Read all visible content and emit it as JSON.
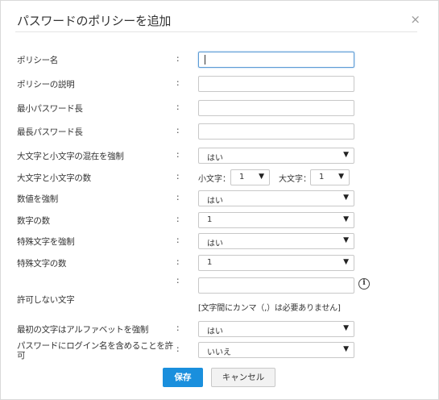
{
  "dialog": {
    "title": "パスワードのポリシーを追加",
    "close_glyph": "×"
  },
  "colon": ":",
  "fields": {
    "policy_name": {
      "label": "ポリシー名",
      "value": ""
    },
    "policy_desc": {
      "label": "ポリシーの説明",
      "value": ""
    },
    "min_length": {
      "label": "最小パスワード長",
      "value": ""
    },
    "max_length": {
      "label": "最長パスワード長",
      "value": ""
    },
    "mixed_case": {
      "label": "大文字と小文字の混在を強制",
      "value": "はい"
    },
    "case_count": {
      "label": "大文字と小文字の数",
      "lower_label": "小文字：",
      "lower_value": "1",
      "upper_label": "大文字：",
      "upper_value": "1"
    },
    "force_numeric": {
      "label": "数値を強制",
      "value": "はい"
    },
    "numeric_count": {
      "label": "数字の数",
      "value": "1"
    },
    "force_special": {
      "label": "特殊文字を強制",
      "value": "はい"
    },
    "special_count": {
      "label": "特殊文字の数",
      "value": "1"
    },
    "disallowed_chars": {
      "label": "許可しない文字",
      "value": "",
      "hint": "[文字間にカンマ（,）は必要ありません]"
    },
    "first_alpha": {
      "label": "最初の文字はアルファベットを強制",
      "value": "はい"
    },
    "include_login": {
      "label_line1": "パスワードにログイン名を含めることを許",
      "label_line2": "可",
      "value": "いいえ"
    }
  },
  "buttons": {
    "save": "保存",
    "cancel": "キャンセル"
  }
}
